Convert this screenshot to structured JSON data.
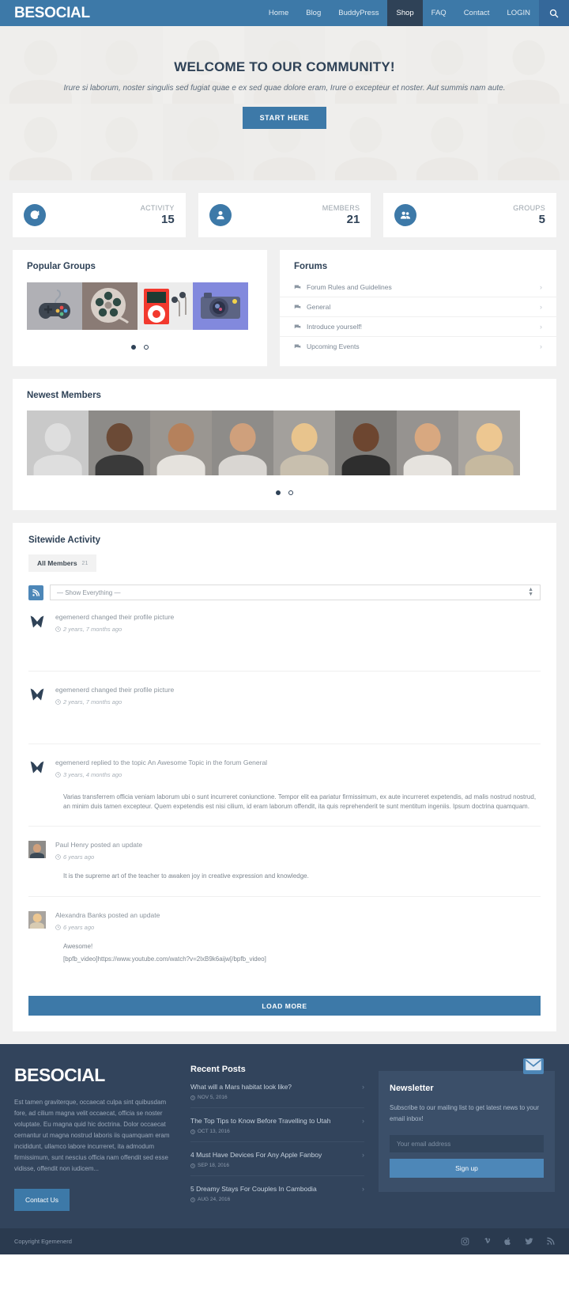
{
  "header": {
    "brand": "BESOCIAL",
    "nav": [
      {
        "label": "Home",
        "active": false
      },
      {
        "label": "Blog",
        "active": false
      },
      {
        "label": "BuddyPress",
        "active": false
      },
      {
        "label": "Shop",
        "active": true
      },
      {
        "label": "FAQ",
        "active": false
      },
      {
        "label": "Contact",
        "active": false
      },
      {
        "label": "LOGIN",
        "active": false
      }
    ],
    "search_icon": "search-icon"
  },
  "hero": {
    "title": "WELCOME TO OUR COMMUNITY!",
    "subtitle": "Irure si laborum, noster singulis sed fugiat quae e ex sed quae dolore eram, Irure o excepteur et noster. Aut summis nam aute.",
    "cta": "START HERE"
  },
  "stats": [
    {
      "label": "ACTIVITY",
      "value": "15",
      "icon": "refresh-icon"
    },
    {
      "label": "MEMBERS",
      "value": "21",
      "icon": "user-icon"
    },
    {
      "label": "GROUPS",
      "value": "5",
      "icon": "users-icon"
    }
  ],
  "groups": {
    "title": "Popular Groups",
    "tiles": [
      "gamepad-thumbnail",
      "film-reel-thumbnail",
      "ipod-thumbnail",
      "camera-thumbnail"
    ],
    "dots": 2,
    "active_dot": 0
  },
  "forums": {
    "title": "Forums",
    "items": [
      {
        "label": "Forum Rules and Guidelines"
      },
      {
        "label": "General"
      },
      {
        "label": "Introduce yourself!"
      },
      {
        "label": "Upcoming Events"
      }
    ]
  },
  "newest_members": {
    "title": "Newest Members",
    "avatars": [
      "placeholder-avatar",
      "member-avatar-2",
      "member-avatar-3",
      "member-avatar-4",
      "member-avatar-5",
      "member-avatar-6",
      "member-avatar-7",
      "member-avatar-8"
    ],
    "dots": 2,
    "active_dot": 0
  },
  "activity": {
    "title": "Sitewide Activity",
    "tab_label": "All Members",
    "tab_count": "21",
    "rss_icon": "rss-icon",
    "filter_value": "— Show Everything —",
    "items": [
      {
        "author": "egemenerd",
        "text": "egemenerd changed their profile picture",
        "time": "2 years, 7 months ago",
        "content": "",
        "content2": "",
        "avatar": "logo-avatar"
      },
      {
        "author": "egemenerd",
        "text": "egemenerd changed their profile picture",
        "time": "2 years, 7 months ago",
        "content": "",
        "content2": "",
        "avatar": "logo-avatar"
      },
      {
        "author": "egemenerd",
        "text": "egemenerd replied to the topic An Awesome Topic in the forum General",
        "time": "3 years, 4 months ago",
        "content": "Varias transferrem officia veniam laborum ubi o sunt incurreret coniunctione. Tempor elit ea pariatur firmissimum, ex aute incurreret expetendis, ad malis nostrud nostrud, an minim duis tamen excepteur. Quem expetendis est nisi cilium, id eram laborum offendit, ita quis reprehenderit te sunt mentitum ingeniis. Ipsum doctrina quamquam.",
        "content2": "",
        "avatar": "logo-avatar"
      },
      {
        "author": "Paul Henry",
        "text": "Paul Henry posted an update",
        "time": "6 years ago",
        "content": "It is the supreme art of the teacher to awaken joy in creative expression and knowledge.",
        "content2": "",
        "avatar": "paul-henry-avatar"
      },
      {
        "author": "Alexandra Banks",
        "text": "Alexandra Banks posted an update",
        "time": "6 years ago",
        "content": "Awesome!",
        "content2": "[bpfb_video]https://www.youtube.com/watch?v=2lxB9k6aijw[/bpfb_video]",
        "avatar": "alexandra-banks-avatar"
      }
    ],
    "load_more": "LOAD MORE"
  },
  "footer": {
    "brand": "BESOCIAL",
    "about": "Est tamen graviterque, occaecat culpa sint quibusdam fore, ad cilium magna velit occaecat, officia se noster voluptate. Eu magna quid hic doctrina. Dolor occaecat cernantur ut magna nostrud laboris iis quamquam eram incididunt, ullamco labore incurreret, ita admodum firmissimum, sunt nescius officia nam offendit sed esse vidisse, offendit non iudicem...",
    "contact_button": "Contact Us",
    "recent_posts_title": "Recent Posts",
    "recent_posts": [
      {
        "title": "What will a Mars habitat look like?",
        "date": "NOV 5, 2016"
      },
      {
        "title": "The Top Tips to Know Before Travelling to Utah",
        "date": "OCT 13, 2016"
      },
      {
        "title": "4 Must Have Devices For Any Apple Fanboy",
        "date": "SEP 18, 2016"
      },
      {
        "title": "5 Dreamy Stays For Couples In Cambodia",
        "date": "AUG 24, 2016"
      }
    ],
    "newsletter": {
      "title": "Newsletter",
      "description": "Subscribe to our mailing list to get latest news to your email inbox!",
      "placeholder": "Your email address",
      "button": "Sign up",
      "icon": "envelope-icon"
    },
    "copyright": "Copyright Egemenerd",
    "socials": [
      "instagram-icon",
      "vimeo-icon",
      "apple-icon",
      "twitter-icon",
      "rss-icon"
    ]
  },
  "colors": {
    "brand_blue": "#3d79a8",
    "dark_navy": "#2f4257",
    "footer_bg": "#32445c",
    "copyright_bg": "#2a3a4f",
    "page_bg": "#f0f0f0"
  }
}
